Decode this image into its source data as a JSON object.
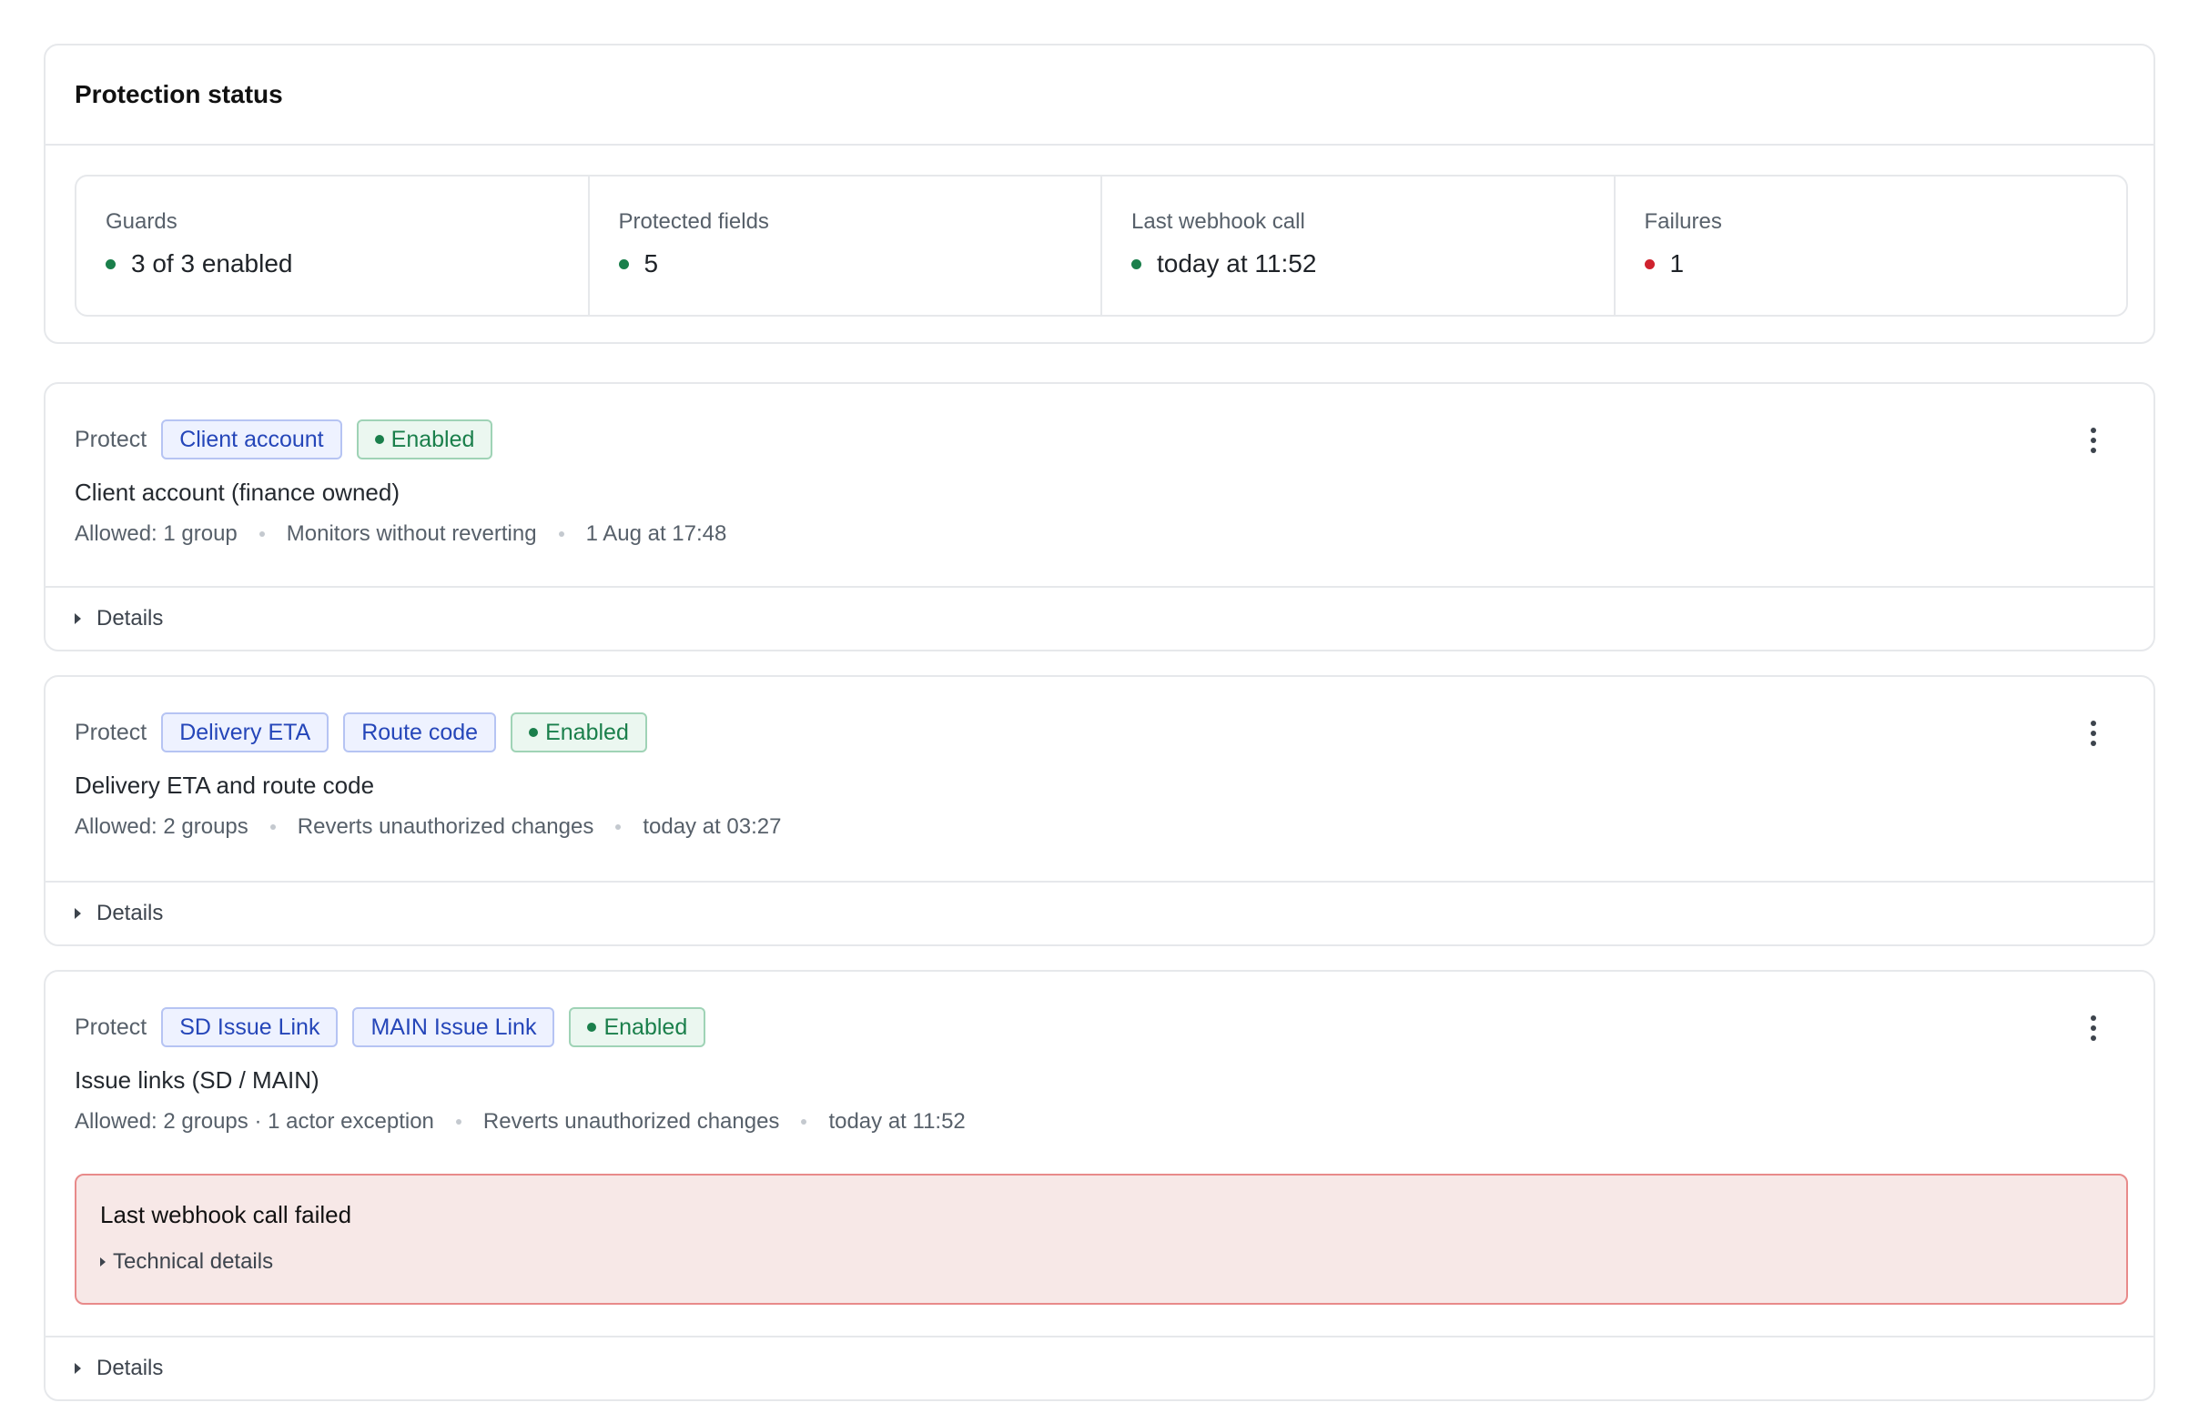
{
  "status": {
    "title": "Protection status",
    "cells": [
      {
        "label": "Guards",
        "value": "3 of 3 enabled",
        "state": "ok"
      },
      {
        "label": "Protected fields",
        "value": "5",
        "state": "ok"
      },
      {
        "label": "Last webhook call",
        "value": "today at 11:52",
        "state": "ok"
      },
      {
        "label": "Failures",
        "value": "1",
        "state": "error"
      }
    ]
  },
  "colors": {
    "ok": "#1a7f4b",
    "error": "#cf222e",
    "field_tag": "#2546b9"
  },
  "guards": [
    {
      "protect_label": "Protect",
      "fields": [
        "Client account"
      ],
      "status": "Enabled",
      "name": "Client account (finance owned)",
      "meta": [
        "Allowed: 1 group",
        "Monitors without reverting",
        "1 Aug at 17:48"
      ],
      "details_label": "Details"
    },
    {
      "protect_label": "Protect",
      "fields": [
        "Delivery ETA",
        "Route code"
      ],
      "status": "Enabled",
      "name": "Delivery ETA and route code",
      "meta": [
        "Allowed: 2 groups",
        "Reverts unauthorized changes",
        "today at 03:27"
      ],
      "details_label": "Details"
    },
    {
      "protect_label": "Protect",
      "fields": [
        "SD Issue Link",
        "MAIN Issue Link"
      ],
      "status": "Enabled",
      "name": "Issue links (SD / MAIN)",
      "meta": [
        "Allowed: 2 groups · 1 actor exception",
        "Reverts unauthorized changes",
        "today at 11:52"
      ],
      "error": {
        "title": "Last webhook call failed",
        "technical_label": "Technical details"
      },
      "details_label": "Details"
    }
  ],
  "icons": {
    "menu": "kebab-menu-icon",
    "expand": "caret-right-icon",
    "status": "status-dot-icon"
  }
}
